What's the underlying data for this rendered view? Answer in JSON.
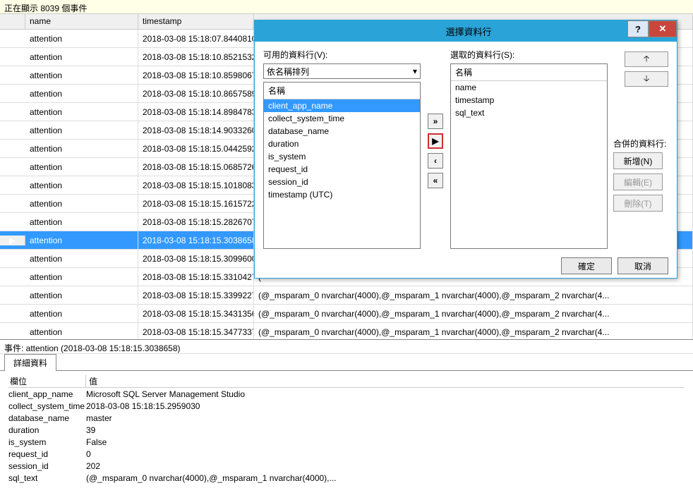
{
  "status_bar": "正在顯示 8039 個事件",
  "grid": {
    "headers": {
      "name": "name",
      "timestamp": "timestamp"
    },
    "selected_index": 12,
    "truncated_cell": "(",
    "long_text": "(@_msparam_0 nvarchar(4000),@_msparam_1 nvarchar(4000),@_msparam_2 nvarchar(4...",
    "rows": [
      {
        "name": "attention",
        "timestamp": "2018-03-08 15:18:07.8440810",
        "text": "("
      },
      {
        "name": "attention",
        "timestamp": "2018-03-08 15:18:10.8521532",
        "text": "("
      },
      {
        "name": "attention",
        "timestamp": "2018-03-08 15:18:10.8598067",
        "text": "("
      },
      {
        "name": "attention",
        "timestamp": "2018-03-08 15:18:10.8657589",
        "text": "("
      },
      {
        "name": "attention",
        "timestamp": "2018-03-08 15:18:14.8984783",
        "text": "("
      },
      {
        "name": "attention",
        "timestamp": "2018-03-08 15:18:14.9033260",
        "text": "("
      },
      {
        "name": "attention",
        "timestamp": "2018-03-08 15:18:15.0442592",
        "text": "("
      },
      {
        "name": "attention",
        "timestamp": "2018-03-08 15:18:15.0685726",
        "text": "("
      },
      {
        "name": "attention",
        "timestamp": "2018-03-08 15:18:15.1018083",
        "text": "("
      },
      {
        "name": "attention",
        "timestamp": "2018-03-08 15:18:15.1615722",
        "text": "("
      },
      {
        "name": "attention",
        "timestamp": "2018-03-08 15:18:15.2826707",
        "text": "("
      },
      {
        "name": "attention",
        "timestamp": "2018-03-08 15:18:15.3038658",
        "text": "("
      },
      {
        "name": "attention",
        "timestamp": "2018-03-08 15:18:15.3099600",
        "text": "("
      },
      {
        "name": "attention",
        "timestamp": "2018-03-08 15:18:15.3310427",
        "text": "("
      },
      {
        "name": "attention",
        "timestamp": "2018-03-08 15:18:15.3399227",
        "text": "(@_msparam_0 nvarchar(4000),@_msparam_1 nvarchar(4000),@_msparam_2 nvarchar(4..."
      },
      {
        "name": "attention",
        "timestamp": "2018-03-08 15:18:15.3431356",
        "text": "(@_msparam_0 nvarchar(4000),@_msparam_1 nvarchar(4000),@_msparam_2 nvarchar(4..."
      },
      {
        "name": "attention",
        "timestamp": "2018-03-08 15:18:15.3477337",
        "text": "(@_msparam_0 nvarchar(4000),@_msparam_1 nvarchar(4000),@_msparam_2 nvarchar(4..."
      }
    ]
  },
  "event_detail": {
    "header": "事件: attention (2018-03-08 15:18:15.3038658)",
    "tab": "詳細資料",
    "col_field": "欄位",
    "col_value": "值",
    "rows": [
      {
        "field": "client_app_name",
        "value": "Microsoft SQL Server Management Studio"
      },
      {
        "field": "collect_system_time",
        "value": "2018-03-08 15:18:15.2959030"
      },
      {
        "field": "database_name",
        "value": "master"
      },
      {
        "field": "duration",
        "value": "39"
      },
      {
        "field": "is_system",
        "value": "False"
      },
      {
        "field": "request_id",
        "value": "0"
      },
      {
        "field": "session_id",
        "value": "202"
      },
      {
        "field": "sql_text",
        "value": "(@_msparam_0 nvarchar(4000),@_msparam_1 nvarchar(4000),..."
      }
    ]
  },
  "dialog": {
    "title": "選擇資料行",
    "available_label": "可用的資料行(V):",
    "selected_label": "選取的資料行(S):",
    "sort_value": "依名稱排列",
    "list_header": "名稱",
    "available_items": [
      "client_app_name",
      "collect_system_time",
      "database_name",
      "duration",
      "is_system",
      "request_id",
      "session_id",
      "timestamp (UTC)"
    ],
    "selected_items": [
      "name",
      "timestamp",
      "sql_text"
    ],
    "merge_label": "合併的資料行:",
    "btn_add": "新增(N)",
    "btn_edit": "編輯(E)",
    "btn_delete": "刪除(T)",
    "btn_ok": "確定",
    "btn_cancel": "取消",
    "arrows": {
      "all_right": "»",
      "right": "▶",
      "left": "‹",
      "all_left": "«",
      "up": "🡡",
      "down": "🡣"
    }
  }
}
